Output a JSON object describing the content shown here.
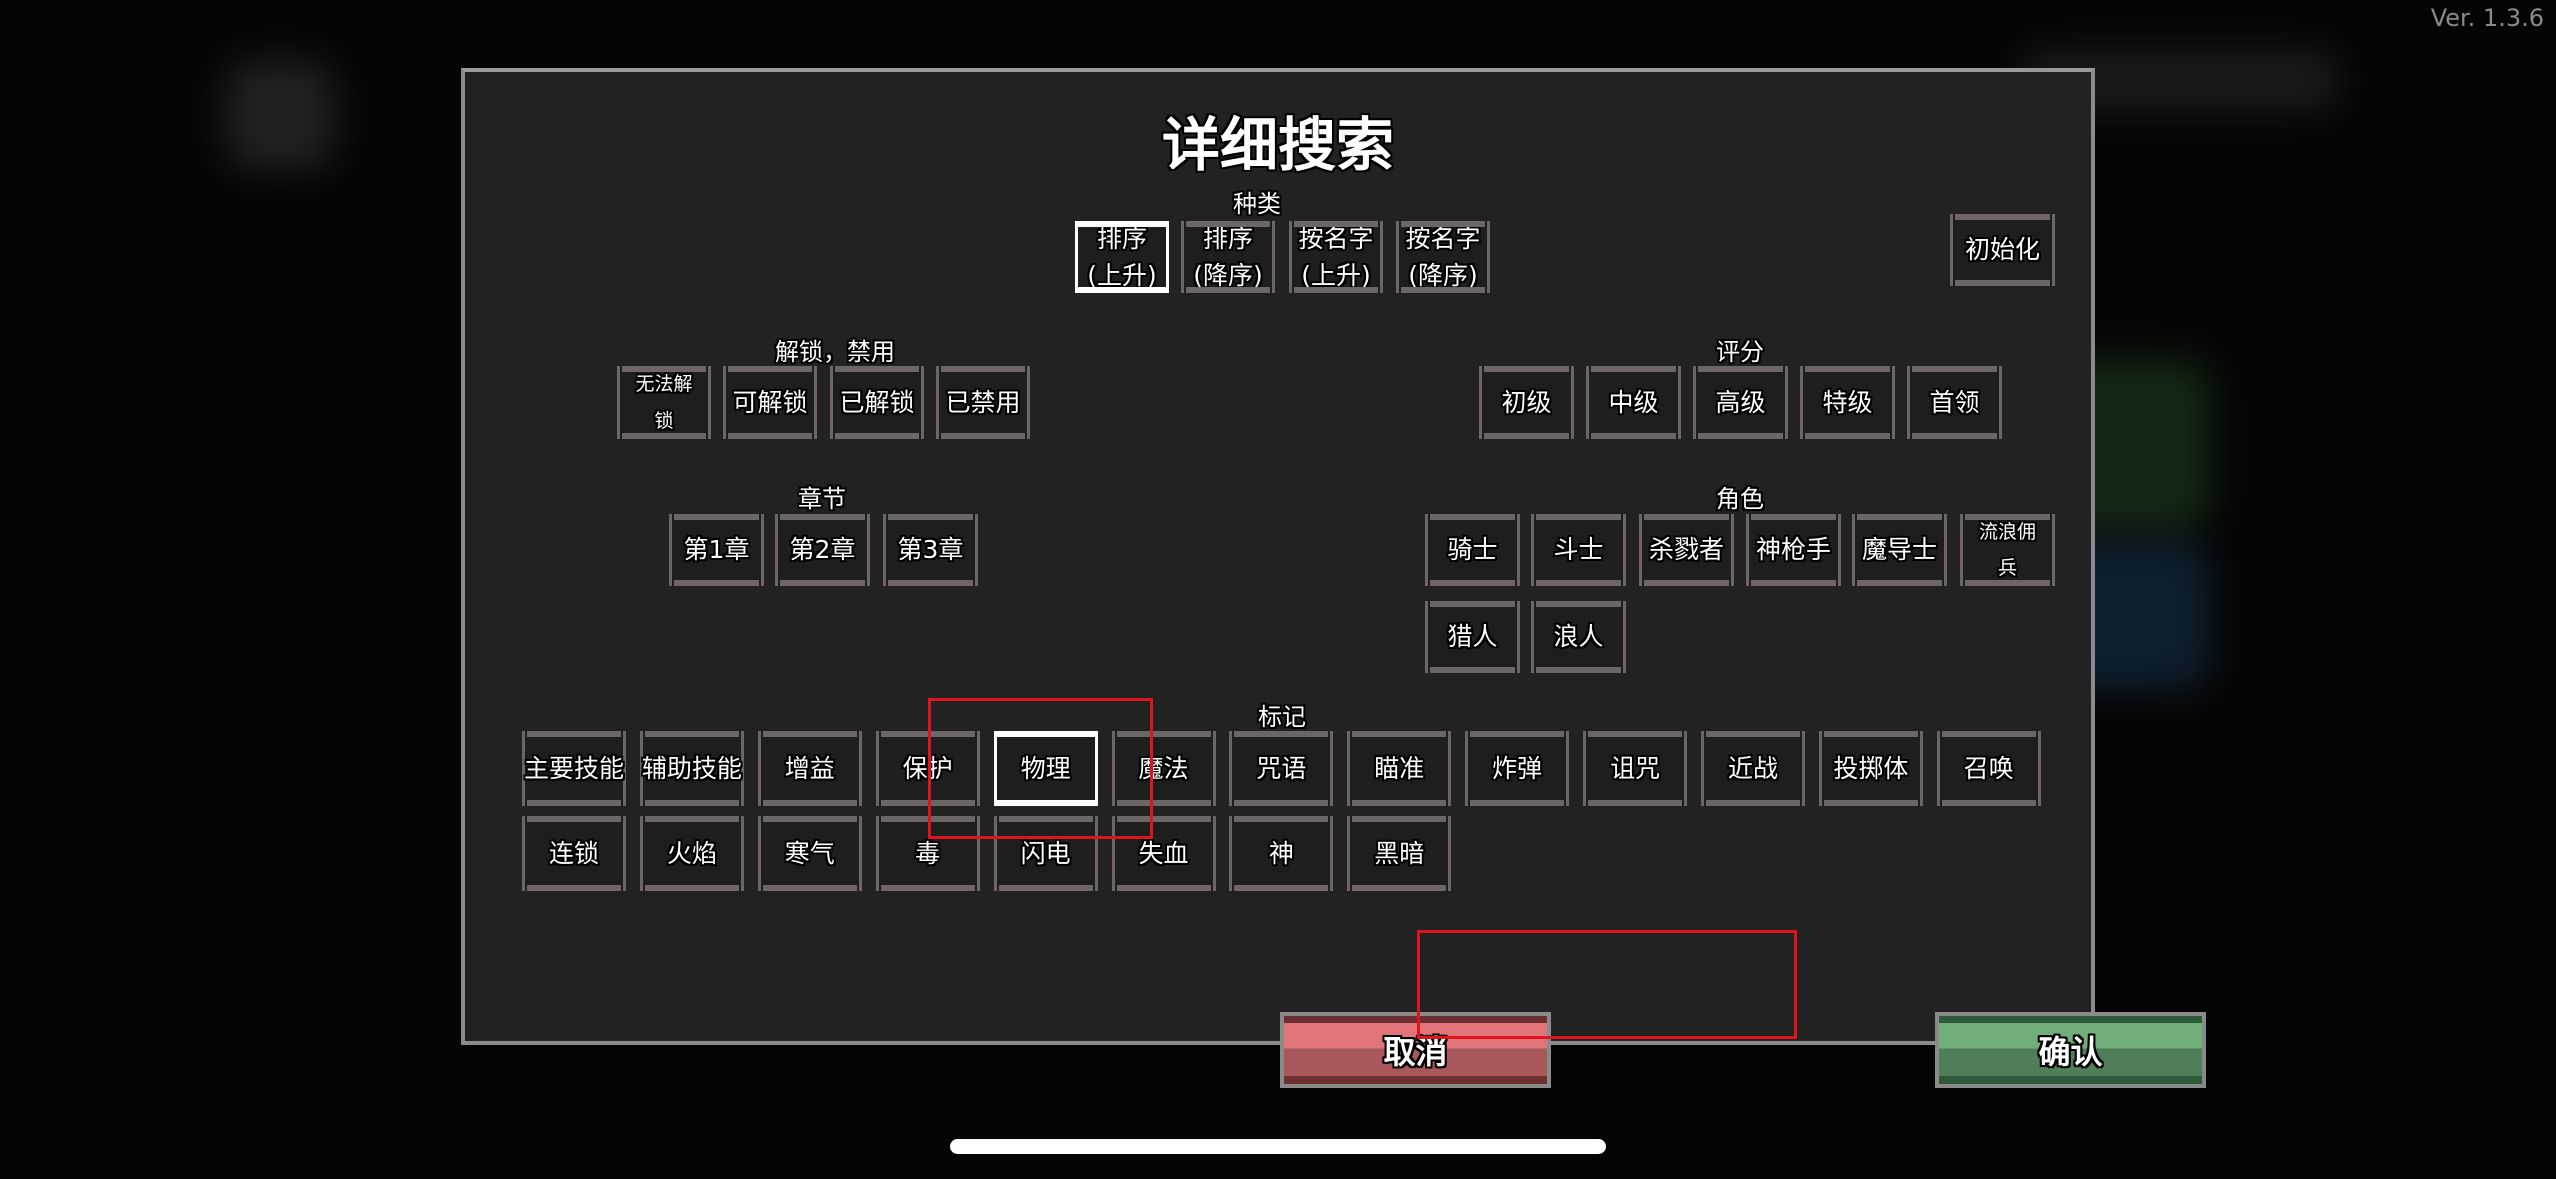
{
  "version": "Ver. 1.3.6",
  "dialog": {
    "title": "详细搜索",
    "sections": {
      "type": {
        "label": "种类",
        "options": [
          "排序\n(上升)",
          "排序\n(降序)",
          "按名字\n(上升)",
          "按名字\n(降序)"
        ],
        "selected": 0
      },
      "unlock": {
        "label": "解锁，禁用",
        "options": [
          "无法解\n锁",
          "可解锁",
          "已解锁",
          "已禁用"
        ]
      },
      "rating": {
        "label": "评分",
        "options": [
          "初级",
          "中级",
          "高级",
          "特级",
          "首领"
        ]
      },
      "chapter": {
        "label": "章节",
        "options": [
          "第1章",
          "第2章",
          "第3章"
        ]
      },
      "role": {
        "label": "角色",
        "options": [
          "骑士",
          "斗士",
          "杀戮者",
          "神枪手",
          "魔导士",
          "流浪佣\n兵",
          "猎人",
          "浪人"
        ]
      },
      "tag": {
        "label": "标记",
        "options": [
          "主要技能",
          "辅助技能",
          "增益",
          "保护",
          "物理",
          "魔法",
          "咒语",
          "瞄准",
          "炸弹",
          "诅咒",
          "近战",
          "投掷体",
          "召唤",
          "连锁",
          "火焰",
          "寒气",
          "毒",
          "闪电",
          "失血",
          "神",
          "黑暗"
        ],
        "selected": 4
      }
    },
    "reset_label": "初始化",
    "cancel_label": "取消",
    "confirm_label": "确认"
  },
  "colors": {
    "highlight_box": "#e0141e",
    "cancel": "#e07478",
    "confirm": "#72ae7a",
    "selected_border": "#ffffff"
  }
}
